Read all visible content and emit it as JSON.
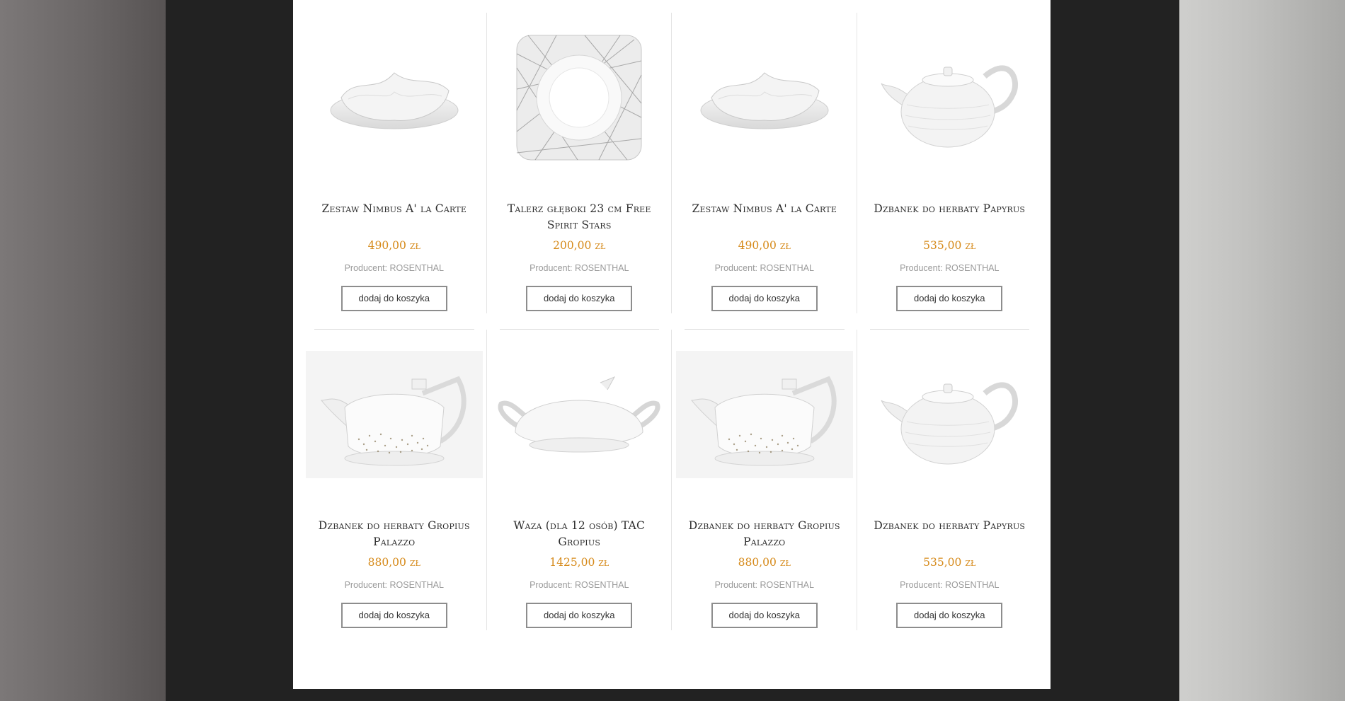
{
  "products": [
    {
      "name": "Zestaw Nimbus A' la Carte",
      "price": "490,00 zł",
      "producer_prefix": "Producent:",
      "producer": "ROSENTHAL",
      "button": "dodaj do koszyka",
      "image": "nimbus-bowl-set"
    },
    {
      "name": "Talerz głęboki 23 cm Free Spirit Stars",
      "price": "200,00 zł",
      "producer_prefix": "Producent:",
      "producer": "ROSENTHAL",
      "button": "dodaj do koszyka",
      "image": "square-plate-stars"
    },
    {
      "name": "Zestaw Nimbus A' la Carte",
      "price": "490,00 zł",
      "producer_prefix": "Producent:",
      "producer": "ROSENTHAL",
      "button": "dodaj do koszyka",
      "image": "nimbus-bowl-set"
    },
    {
      "name": "Dzbanek do herbaty Papyrus",
      "price": "535,00 zł",
      "producer_prefix": "Producent:",
      "producer": "ROSENTHAL",
      "button": "dodaj do koszyka",
      "image": "papyrus-teapot"
    },
    {
      "name": "Dzbanek do herbaty Gropius Palazzo",
      "price": "880,00 zł",
      "producer_prefix": "Producent:",
      "producer": "ROSENTHAL",
      "button": "dodaj do koszyka",
      "image": "gropius-teapot-gold"
    },
    {
      "name": "Waza (dla 12 osób) TAC Gropius",
      "price": "1425,00 zł",
      "producer_prefix": "Producent:",
      "producer": "ROSENTHAL",
      "button": "dodaj do koszyka",
      "image": "tac-tureen"
    },
    {
      "name": "Dzbanek do herbaty Gropius Palazzo",
      "price": "880,00 zł",
      "producer_prefix": "Producent:",
      "producer": "ROSENTHAL",
      "button": "dodaj do koszyka",
      "image": "gropius-teapot-gold"
    },
    {
      "name": "Dzbanek do herbaty Papyrus",
      "price": "535,00 zł",
      "producer_prefix": "Producent:",
      "producer": "ROSENTHAL",
      "button": "dodaj do koszyka",
      "image": "papyrus-teapot"
    }
  ],
  "colors": {
    "price": "#d68a1a",
    "button_border": "#8d8d8d",
    "page_bg": "#222222"
  }
}
